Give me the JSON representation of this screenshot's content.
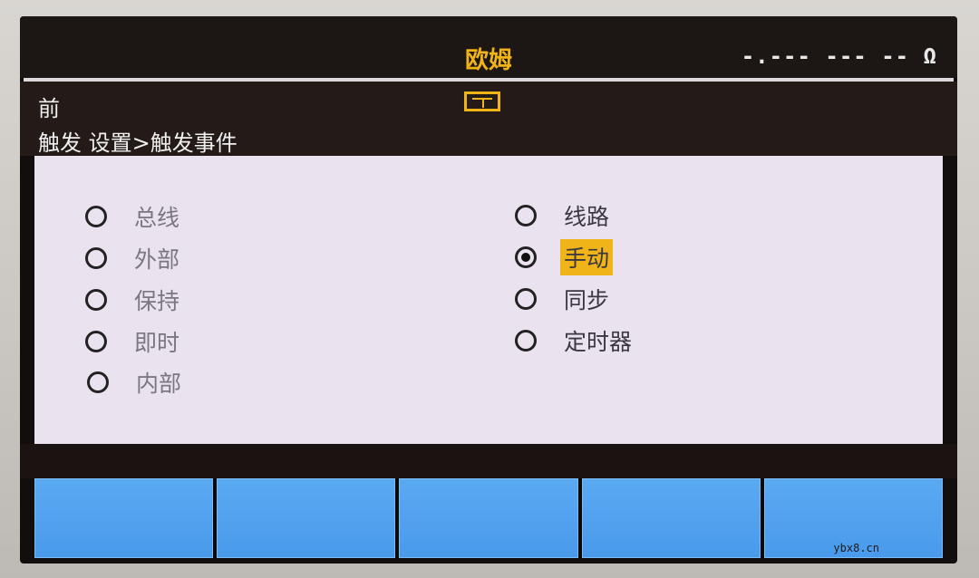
{
  "header": {
    "title": "欧姆",
    "reading": "-.--- --- -- Ω"
  },
  "info": {
    "front_label": "前",
    "breadcrumb": "触发 设置>触发事件"
  },
  "options_left": [
    {
      "label": "总线",
      "checked": false
    },
    {
      "label": "外部",
      "checked": false
    },
    {
      "label": "保持",
      "checked": false
    },
    {
      "label": "即时",
      "checked": false
    },
    {
      "label": "内部",
      "checked": false
    }
  ],
  "options_right": [
    {
      "label": "线路",
      "checked": false
    },
    {
      "label": "手动",
      "checked": true
    },
    {
      "label": "同步",
      "checked": false
    },
    {
      "label": "定时器",
      "checked": false
    }
  ],
  "softkeys": [
    "",
    "",
    "",
    "",
    ""
  ],
  "watermark": "ybx8.cn",
  "colors": {
    "accent": "#f0b418",
    "softkey": "#4a9aec",
    "panel": "#ebe2ef"
  },
  "icons": {
    "trigger": "trigger-mode-icon"
  }
}
